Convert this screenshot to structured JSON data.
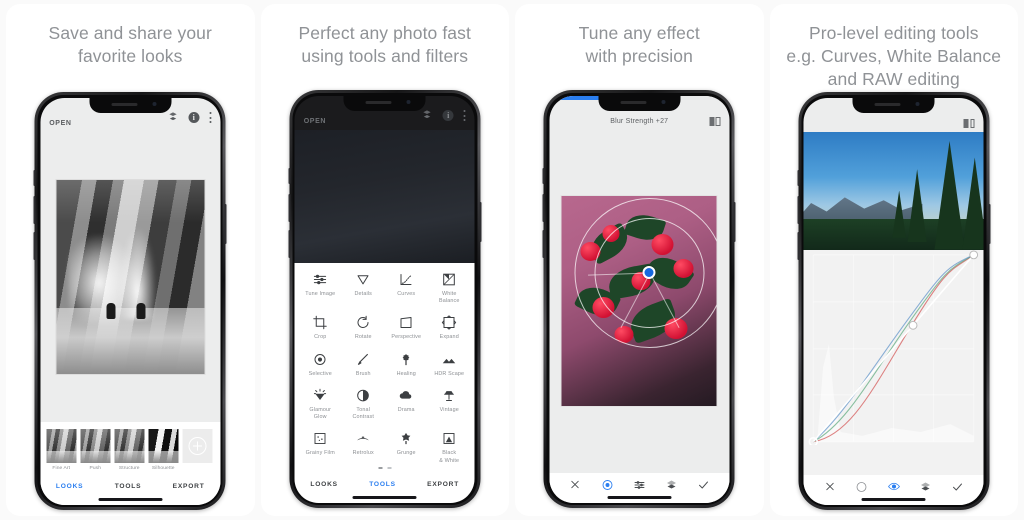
{
  "panels": [
    {
      "caption": "Save and share your\nfavorite looks",
      "appbar": {
        "open_label": "OPEN",
        "icons": [
          "stacks-icon",
          "info-icon",
          "overflow-menu-icon"
        ]
      },
      "looks": [
        {
          "label": "Fine Art"
        },
        {
          "label": "Push"
        },
        {
          "label": "Structure"
        },
        {
          "label": "Silhouette"
        }
      ],
      "add_look_label": "+",
      "tabs": [
        {
          "label": "LOOKS",
          "active": true
        },
        {
          "label": "TOOLS",
          "active": false
        },
        {
          "label": "EXPORT",
          "active": false
        }
      ]
    },
    {
      "caption": "Perfect any photo fast\nusing tools and filters",
      "appbar": {
        "open_label": "OPEN",
        "icons": [
          "stacks-icon",
          "info-icon",
          "overflow-menu-icon"
        ]
      },
      "tools": [
        {
          "label": "Tune Image",
          "icon": "sliders-icon"
        },
        {
          "label": "Details",
          "icon": "triangle-down-icon"
        },
        {
          "label": "Curves",
          "icon": "curves-icon"
        },
        {
          "label": "White\nBalance",
          "icon": "white-balance-icon"
        },
        {
          "label": "Crop",
          "icon": "crop-icon"
        },
        {
          "label": "Rotate",
          "icon": "rotate-icon"
        },
        {
          "label": "Perspective",
          "icon": "perspective-icon"
        },
        {
          "label": "Expand",
          "icon": "expand-icon"
        },
        {
          "label": "Selective",
          "icon": "selective-icon"
        },
        {
          "label": "Brush",
          "icon": "brush-icon"
        },
        {
          "label": "Healing",
          "icon": "healing-icon"
        },
        {
          "label": "HDR Scape",
          "icon": "hdr-scape-icon"
        },
        {
          "label": "Glamour\nGlow",
          "icon": "glamour-glow-icon"
        },
        {
          "label": "Tonal\nContrast",
          "icon": "tonal-contrast-icon"
        },
        {
          "label": "Drama",
          "icon": "drama-icon"
        },
        {
          "label": "Vintage",
          "icon": "vintage-icon"
        },
        {
          "label": "Grainy Film",
          "icon": "grainy-film-icon"
        },
        {
          "label": "Retrolux",
          "icon": "retrolux-icon"
        },
        {
          "label": "Grunge",
          "icon": "grunge-icon"
        },
        {
          "label": "Black\n& White",
          "icon": "black-white-icon"
        }
      ],
      "tabs": [
        {
          "label": "LOOKS",
          "active": false
        },
        {
          "label": "TOOLS",
          "active": true
        },
        {
          "label": "EXPORT",
          "active": false
        }
      ]
    },
    {
      "caption": "Tune any effect\nwith precision",
      "parameter_label": "Blur Strength +27",
      "slider_percent": 27,
      "toolbar": [
        {
          "icon": "close-icon",
          "active": false
        },
        {
          "icon": "radial-target-icon",
          "active": true
        },
        {
          "icon": "adjust-sliders-icon",
          "active": false
        },
        {
          "icon": "stack-layers-icon",
          "active": false
        },
        {
          "icon": "check-icon",
          "active": false
        }
      ]
    },
    {
      "caption": "Pro-level editing tools\ne.g. Curves, White Balance\nand RAW editing",
      "compare_icon": "compare-icon",
      "toolbar": [
        {
          "icon": "close-icon",
          "active": false
        },
        {
          "icon": "channel-circle-icon",
          "active": false
        },
        {
          "icon": "eye-icon",
          "active": true
        },
        {
          "icon": "stack-layers-icon",
          "active": false
        },
        {
          "icon": "check-icon",
          "active": false
        }
      ],
      "curves": {
        "control_points": [
          [
            0,
            0
          ],
          [
            0.62,
            0.62
          ],
          [
            1.0,
            1.0
          ]
        ],
        "grid_divisions": 4,
        "channels": [
          "white",
          "red",
          "green",
          "blue"
        ]
      }
    }
  ],
  "colors": {
    "accent": "#2a7ef0",
    "caption": "#8f9296",
    "card_bg": "#ffffff",
    "page_bg": "#fafafa",
    "screen_bg": "#eceded"
  }
}
